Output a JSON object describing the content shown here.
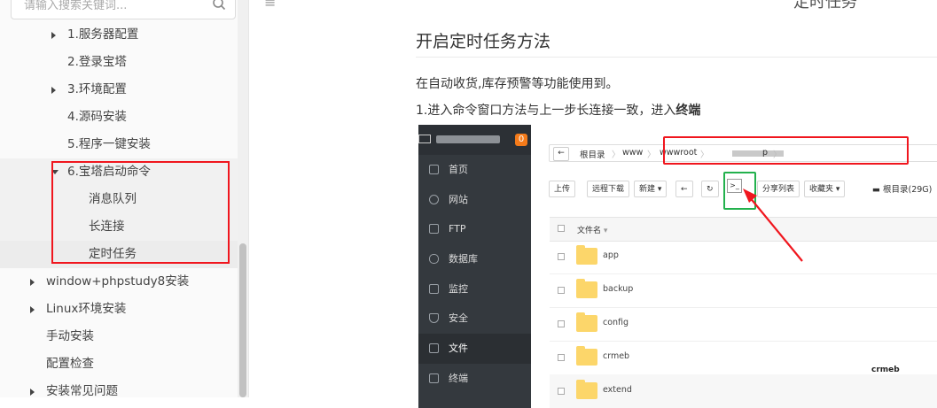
{
  "sidebar": {
    "search": {
      "placeholder": "请输入搜索关键词..."
    },
    "items": [
      {
        "label": "1.服务器配置",
        "level": 2,
        "caret": "right"
      },
      {
        "label": "2.登录宝塔",
        "level": 2
      },
      {
        "label": "3.环境配置",
        "level": 2,
        "caret": "right"
      },
      {
        "label": "4.源码安装",
        "level": 2
      },
      {
        "label": "5.程序一键安装",
        "level": 2
      },
      {
        "label": "6.宝塔启动命令",
        "level": 2,
        "caret": "down"
      },
      {
        "label": "消息队列",
        "level": 3
      },
      {
        "label": "长连接",
        "level": 3
      },
      {
        "label": "定时任务",
        "level": 3,
        "active": true
      },
      {
        "label": "window+phpstudy8安装",
        "level": 1,
        "caret": "right"
      },
      {
        "label": "Linux环境安装",
        "level": 1,
        "caret": "right"
      },
      {
        "label": "手动安装",
        "level": 1
      },
      {
        "label": "配置检查",
        "level": 1
      },
      {
        "label": "安装常见问题",
        "level": 1,
        "caret": "right"
      }
    ]
  },
  "header": {
    "page_title": "定时任务"
  },
  "article": {
    "heading": "开启定时任务方法",
    "para1": "在自动收货,库存预警等功能使用到。",
    "para2_prefix": "1.进入命令窗口方法与上一步长连接一致，进入",
    "para2_bold": "终端"
  },
  "screenshot": {
    "badge": "0",
    "nav": [
      {
        "label": "首页"
      },
      {
        "label": "网站"
      },
      {
        "label": "FTP"
      },
      {
        "label": "数据库"
      },
      {
        "label": "监控"
      },
      {
        "label": "安全"
      },
      {
        "label": "文件",
        "active": true
      },
      {
        "label": "终端"
      }
    ],
    "breadcrumb": [
      "根目录",
      "www",
      "wwwroot",
      "p"
    ],
    "toolbar": {
      "upload": "上传",
      "remote_download": "远程下载",
      "new": "新建 ▾",
      "share_list": "分享列表",
      "favorites": "收藏夹 ▾",
      "disk": "根目录(29G)"
    },
    "file_header": "文件名",
    "files": [
      "app",
      "backup",
      "config",
      "crmeb",
      "extend"
    ],
    "watermark": "crmeb"
  },
  "colors": {
    "highlight_red": "#f0161e",
    "highlight_green": "#23b14d",
    "folder": "#fcd66a"
  }
}
